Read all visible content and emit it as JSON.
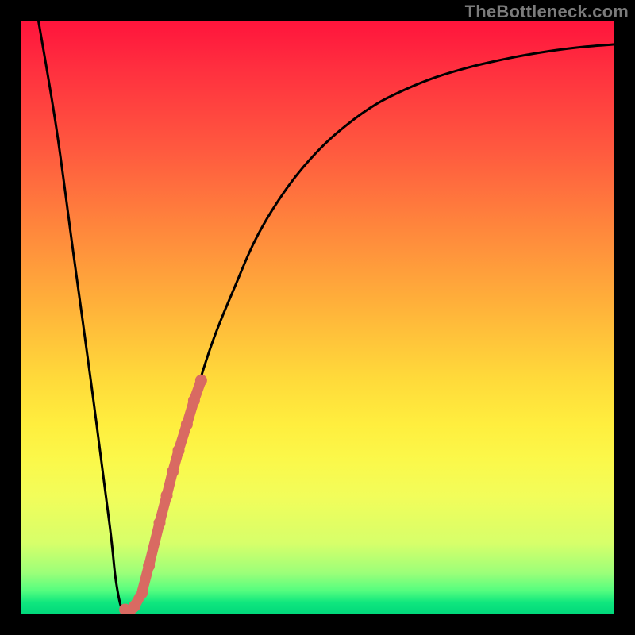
{
  "watermark": "TheBottleneck.com",
  "colors": {
    "curve_stroke": "#000000",
    "marker_stroke": "#d96a62",
    "frame": "#000000"
  },
  "chart_data": {
    "type": "line",
    "title": "",
    "xlabel": "",
    "ylabel": "",
    "xlim": [
      0,
      100
    ],
    "ylim": [
      0,
      100
    ],
    "grid": false,
    "series": [
      {
        "name": "bottleneck-curve",
        "x": [
          3,
          6,
          9,
          12,
          15,
          16,
          17,
          18,
          20,
          24,
          28,
          32,
          36,
          40,
          45,
          50,
          55,
          60,
          65,
          70,
          75,
          80,
          85,
          90,
          95,
          100
        ],
        "y": [
          100,
          82,
          60,
          38,
          15,
          6,
          1,
          0.4,
          3,
          18,
          32,
          45,
          55,
          64,
          72,
          78,
          82.5,
          86,
          88.5,
          90.5,
          92,
          93.2,
          94.2,
          95,
          95.6,
          96
        ]
      }
    ],
    "annotations": [
      {
        "name": "highlight-markers",
        "x": [
          17.6,
          18.4,
          19.2,
          20.4,
          21.6,
          23.4,
          24.6,
          25.6,
          26.6,
          28.0,
          29.2,
          30.4
        ],
        "y": [
          0.8,
          0.6,
          1.4,
          3.6,
          8.2,
          15.4,
          20.0,
          24.0,
          27.6,
          32.0,
          36.0,
          39.4
        ]
      }
    ]
  }
}
